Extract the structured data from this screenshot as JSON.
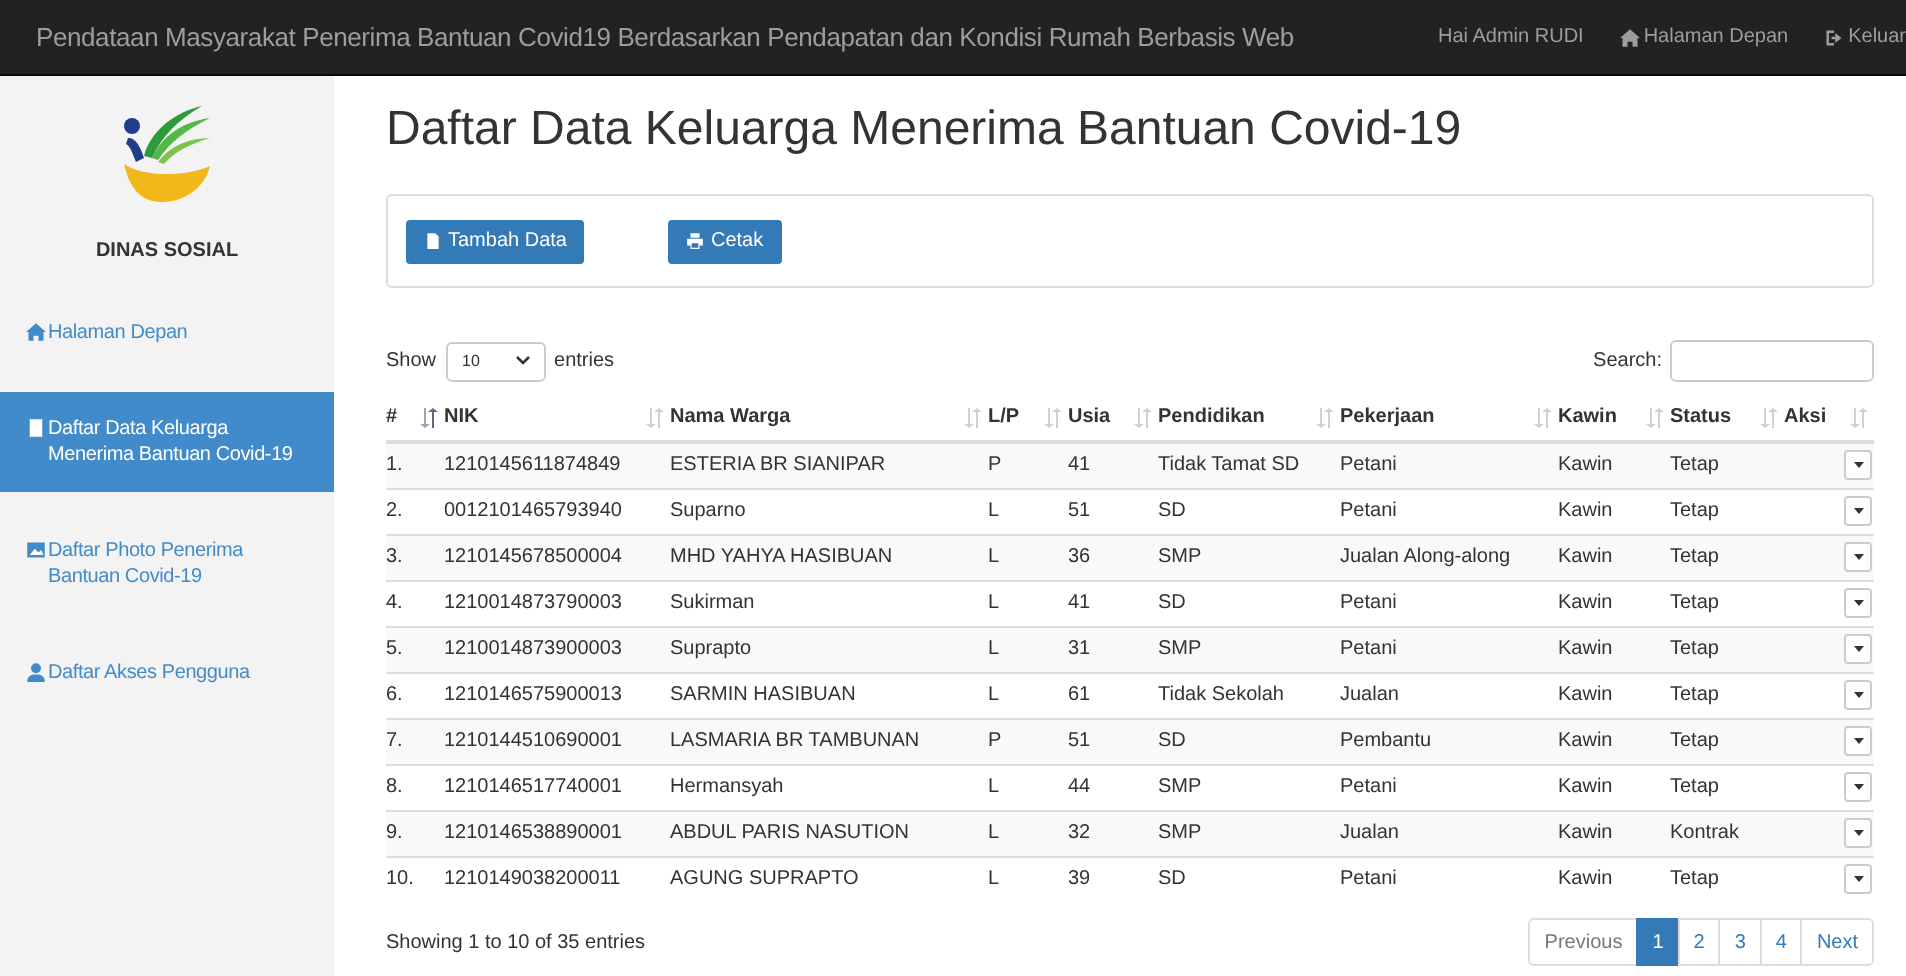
{
  "navbar": {
    "title": "Pendataan Masyarakat Penerima Bantuan Covid19 Berdasarkan Pendapatan dan Kondisi Rumah Berbasis Web",
    "greeting": "Hai Admin RUDI",
    "links": [
      {
        "label": "Halaman Depan",
        "kind": "home"
      },
      {
        "label": "Keluar",
        "kind": "logout"
      }
    ]
  },
  "sidebar": {
    "brand": "DINAS SOSIAL",
    "items": [
      {
        "label": "Halaman Depan",
        "kind": "home",
        "selected": false
      },
      {
        "label": "Daftar Data Keluarga Menerima Bantuan Covid-19",
        "kind": "book",
        "selected": true
      },
      {
        "label": "Daftar Photo Penerima Bantuan Covid-19",
        "kind": "picture",
        "selected": false
      },
      {
        "label": "Daftar Akses Pengguna",
        "kind": "user",
        "selected": false
      }
    ]
  },
  "page_title": "Daftar Data Keluarga Menerima Bantuan Covid-19",
  "toolbar": [
    {
      "label": "Tambah Data",
      "kind": "file"
    },
    {
      "label": "Cetak",
      "kind": "print"
    }
  ],
  "length_control": {
    "before": "Show",
    "value": "10",
    "after": "entries"
  },
  "search": {
    "label": "Search:"
  },
  "table": {
    "columns": [
      {
        "label": "#",
        "sorted": true
      },
      {
        "label": "NIK",
        "sorted": false
      },
      {
        "label": "Nama Warga",
        "sorted": false
      },
      {
        "label": "L/P",
        "sorted": false
      },
      {
        "label": "Usia",
        "sorted": false
      },
      {
        "label": "Pendidikan",
        "sorted": false
      },
      {
        "label": "Pekerjaan",
        "sorted": false
      },
      {
        "label": "Kawin",
        "sorted": false
      },
      {
        "label": "Status",
        "sorted": false
      },
      {
        "label": "Aksi",
        "sorted": false
      }
    ],
    "rows": [
      [
        "1.",
        "1210145611874849",
        "ESTERIA BR SIANIPAR",
        "P",
        "41",
        "Tidak Tamat SD",
        "Petani",
        "Kawin",
        "Tetap"
      ],
      [
        "2.",
        "0012101465793940",
        "Suparno",
        "L",
        "51",
        "SD",
        "Petani",
        "Kawin",
        "Tetap"
      ],
      [
        "3.",
        "1210145678500004",
        "MHD YAHYA HASIBUAN",
        "L",
        "36",
        "SMP",
        "Jualan Along-along",
        "Kawin",
        "Tetap"
      ],
      [
        "4.",
        "1210014873790003",
        "Sukirman",
        "L",
        "41",
        "SD",
        "Petani",
        "Kawin",
        "Tetap"
      ],
      [
        "5.",
        "1210014873900003",
        "Suprapto",
        "L",
        "31",
        "SMP",
        "Petani",
        "Kawin",
        "Tetap"
      ],
      [
        "6.",
        "1210146575900013",
        "SARMIN HASIBUAN",
        "L",
        "61",
        "Tidak Sekolah",
        "Jualan",
        "Kawin",
        "Tetap"
      ],
      [
        "7.",
        "1210144510690001",
        "LASMARIA BR TAMBUNAN",
        "P",
        "51",
        "SD",
        "Pembantu",
        "Kawin",
        "Tetap"
      ],
      [
        "8.",
        "1210146517740001",
        "Hermansyah",
        "L",
        "44",
        "SMP",
        "Petani",
        "Kawin",
        "Tetap"
      ],
      [
        "9.",
        "1210146538890001",
        "ABDUL PARIS NASUTION",
        "L",
        "32",
        "SMP",
        "Jualan",
        "Kawin",
        "Kontrak"
      ],
      [
        "10.",
        "1210149038200011",
        "AGUNG SUPRAPTO",
        "L",
        "39",
        "SD",
        "Petani",
        "Kawin",
        "Tetap"
      ]
    ]
  },
  "info": "Showing 1 to 10 of 35 entries",
  "pagination": [
    {
      "label": "Previous",
      "selected": false,
      "disabled": true
    },
    {
      "label": "1",
      "selected": true,
      "disabled": false
    },
    {
      "label": "2",
      "selected": false,
      "disabled": false
    },
    {
      "label": "3",
      "selected": false,
      "disabled": false
    },
    {
      "label": "4",
      "selected": false,
      "disabled": false
    },
    {
      "label": "Next",
      "selected": false,
      "disabled": false
    }
  ]
}
